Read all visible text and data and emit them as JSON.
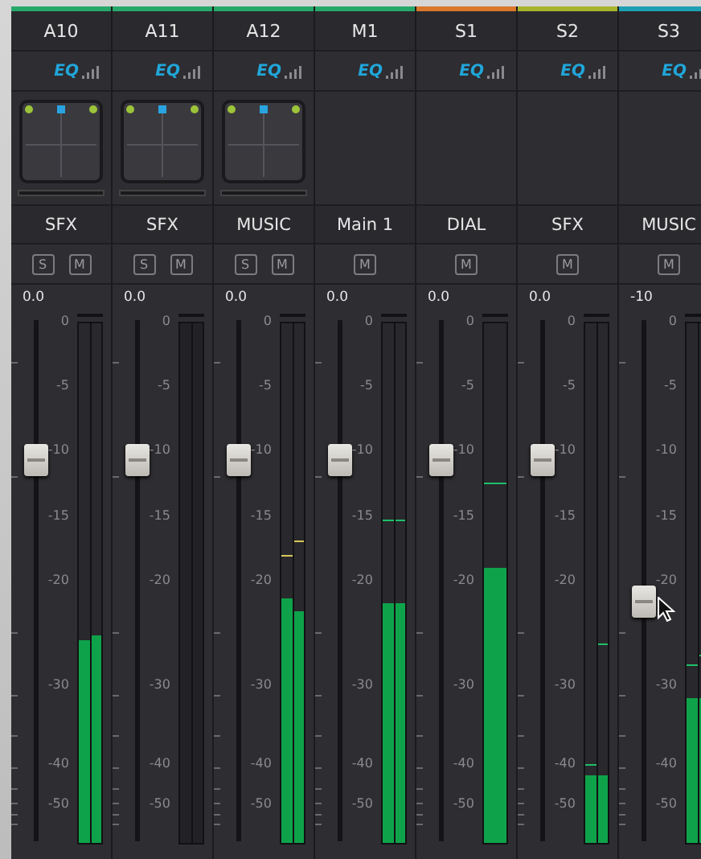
{
  "strips": [
    {
      "name": "A10",
      "color": "#27a86b",
      "eq": "EQ",
      "pan_panel": true,
      "bus": "SFX",
      "buttons": [
        "S",
        "M"
      ],
      "reading": "0.0",
      "fader": {
        "level": 0.73
      },
      "scale": [
        "0",
        "-5",
        "-10",
        "-15",
        "-20",
        "-30",
        "-40",
        "-50"
      ],
      "meters": [
        {
          "kind": "active",
          "fill": {
            "level": 0.39
          }
        },
        {
          "kind": "active",
          "fill": {
            "level": 0.4
          }
        }
      ]
    },
    {
      "name": "A11",
      "color": "#27a86b",
      "eq": "EQ",
      "pan_panel": true,
      "bus": "SFX",
      "buttons": [
        "S",
        "M"
      ],
      "reading": "0.0",
      "fader": {
        "level": 0.73
      },
      "scale": [
        "0",
        "-5",
        "-10",
        "-15",
        "-20",
        "-30",
        "-40",
        "-50"
      ],
      "meters": [
        {
          "kind": "idle"
        },
        {
          "kind": "idle"
        }
      ]
    },
    {
      "name": "A12",
      "color": "#27a86b",
      "eq": "EQ",
      "pan_panel": true,
      "bus": "MUSIC",
      "buttons": [
        "S",
        "M"
      ],
      "reading": "0.0",
      "fader": {
        "level": 0.73
      },
      "scale": [
        "0",
        "-5",
        "-10",
        "-15",
        "-20",
        "-30",
        "-40",
        "-50"
      ],
      "meters": [
        {
          "kind": "active",
          "fill": {
            "level": 0.47
          },
          "peak": {
            "level": 0.55
          }
        },
        {
          "kind": "active",
          "fill": {
            "level": 0.445
          },
          "peak": {
            "level": 0.58
          }
        }
      ]
    },
    {
      "name": "M1",
      "color": "#27a86b",
      "eq": "EQ",
      "pan_panel": false,
      "bus": "Main 1",
      "buttons": [
        "M"
      ],
      "reading": "0.0",
      "fader": {
        "level": 0.73
      },
      "scale": [
        "0",
        "-5",
        "-10",
        "-15",
        "-20",
        "-30",
        "-40",
        "-50"
      ],
      "meters": [
        {
          "kind": "active",
          "fill": {
            "level": 0.46
          },
          "peak": {
            "level": 0.62
          }
        },
        {
          "kind": "active",
          "fill": {
            "level": 0.46
          },
          "peak": {
            "level": 0.62
          }
        }
      ]
    },
    {
      "name": "S1",
      "color": "#d9772b",
      "eq": "EQ",
      "pan_panel": false,
      "bus": "DIAL",
      "buttons": [
        "M"
      ],
      "reading": "0.0",
      "fader": {
        "level": 0.73
      },
      "scale": [
        "0",
        "-5",
        "-10",
        "-15",
        "-20",
        "-30",
        "-40",
        "-50"
      ],
      "meters": [
        {
          "kind": "active",
          "fill": {
            "level": 0.53
          },
          "peak": {
            "level": 0.69
          }
        }
      ]
    },
    {
      "name": "S2",
      "color": "#a6b52d",
      "eq": "EQ",
      "pan_panel": false,
      "bus": "SFX",
      "buttons": [
        "M"
      ],
      "reading": "0.0",
      "fader": {
        "level": 0.73
      },
      "scale": [
        "0",
        "-5",
        "-10",
        "-15",
        "-20",
        "-30",
        "-40",
        "-50"
      ],
      "meters": [
        {
          "kind": "active",
          "fill": {
            "level": 0.13
          },
          "peak": {
            "level": 0.15
          }
        },
        {
          "kind": "active",
          "fill": {
            "level": 0.13
          },
          "peak": {
            "level": 0.38
          }
        }
      ]
    },
    {
      "name": "S3",
      "color": "#1ea0b4",
      "eq": "EQ",
      "pan_panel": false,
      "bus": "MUSIC",
      "buttons": [
        "M"
      ],
      "reading": "-10",
      "fader": {
        "level": 0.46
      },
      "scale": [
        "0",
        "-5",
        "-10",
        "-15",
        "-20",
        "-30",
        "-40",
        "-50"
      ],
      "meters": [
        {
          "kind": "active",
          "fill": {
            "level": 0.28
          },
          "peak": {
            "level": 0.34
          }
        },
        {
          "kind": "active",
          "fill": {
            "level": 0.28
          },
          "peak": {
            "level": 0.36
          }
        }
      ]
    }
  ]
}
